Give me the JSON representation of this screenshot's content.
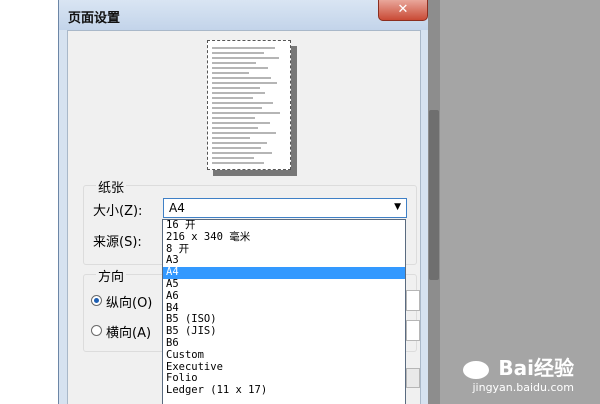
{
  "window": {
    "title": "页面设置",
    "close_glyph": "✕"
  },
  "paper": {
    "group_label": "纸张",
    "size_label": "大小(Z):",
    "size_value": "A4",
    "source_label": "来源(S):"
  },
  "orientation": {
    "group_label": "方向",
    "portrait_label": "纵向(O)",
    "landscape_label": "横向(A)"
  },
  "dropdown_options": [
    "16 开",
    "216 x 340 毫米",
    "8 开",
    "A3",
    "A4",
    "A5",
    "A6",
    "B4",
    "B5 (ISO)",
    "B5 (JIS)",
    "B6",
    "Custom",
    "Executive",
    "Folio",
    "Ledger (11 x 17)"
  ],
  "selected_option_index": 4,
  "watermark": {
    "logo": "Bai经验",
    "url": "jingyan.baidu.com"
  },
  "colors": {
    "selection": "#3399ff",
    "close_button": "#c94a35",
    "focus_border": "#3f80c6"
  }
}
